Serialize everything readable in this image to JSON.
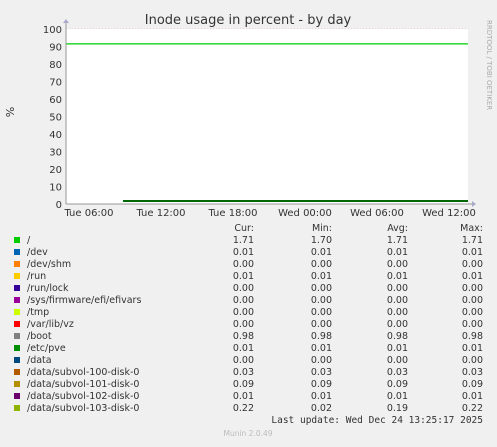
{
  "chart_data": {
    "type": "line",
    "title": "Inode usage in percent - by day",
    "ylabel": "%",
    "side_label": "RRDTOOL / TOBI OETIKER",
    "ylim": [
      0,
      100
    ],
    "y_ticks": [
      0,
      10,
      20,
      30,
      40,
      50,
      60,
      70,
      80,
      90,
      100
    ],
    "x_ticks": [
      "Tue 06:00",
      "Tue 12:00",
      "Tue 18:00",
      "Wed 00:00",
      "Wed 06:00",
      "Wed 12:00"
    ],
    "grid": true,
    "series": [
      {
        "name": "/",
        "color": "#00cc00",
        "values": [
          91.5
        ]
      },
      {
        "name": "/data/subvol-100-disk-0",
        "color": "#006600",
        "values": [
          1.71
        ]
      }
    ]
  },
  "legend": {
    "headers": [
      "Cur:",
      "Min:",
      "Avg:",
      "Max:"
    ],
    "rows": [
      {
        "name": "/",
        "color": "#00cc00",
        "cur": "1.71",
        "min": "1.70",
        "avg": "1.71",
        "max": "1.71"
      },
      {
        "name": "/dev",
        "color": "#0066b3",
        "cur": "0.01",
        "min": "0.01",
        "avg": "0.01",
        "max": "0.01"
      },
      {
        "name": "/dev/shm",
        "color": "#ff8000",
        "cur": "0.00",
        "min": "0.00",
        "avg": "0.00",
        "max": "0.00"
      },
      {
        "name": "/run",
        "color": "#ffcc00",
        "cur": "0.01",
        "min": "0.01",
        "avg": "0.01",
        "max": "0.01"
      },
      {
        "name": "/run/lock",
        "color": "#330099",
        "cur": "0.00",
        "min": "0.00",
        "avg": "0.00",
        "max": "0.00"
      },
      {
        "name": "/sys/firmware/efi/efivars",
        "color": "#990099",
        "cur": "0.00",
        "min": "0.00",
        "avg": "0.00",
        "max": "0.00"
      },
      {
        "name": "/tmp",
        "color": "#ccff00",
        "cur": "0.00",
        "min": "0.00",
        "avg": "0.00",
        "max": "0.00"
      },
      {
        "name": "/var/lib/vz",
        "color": "#ff0000",
        "cur": "0.00",
        "min": "0.00",
        "avg": "0.00",
        "max": "0.00"
      },
      {
        "name": "/boot",
        "color": "#808080",
        "cur": "0.98",
        "min": "0.98",
        "avg": "0.98",
        "max": "0.98"
      },
      {
        "name": "/etc/pve",
        "color": "#008f00",
        "cur": "0.01",
        "min": "0.01",
        "avg": "0.01",
        "max": "0.01"
      },
      {
        "name": "/data",
        "color": "#00487d",
        "cur": "0.00",
        "min": "0.00",
        "avg": "0.00",
        "max": "0.00"
      },
      {
        "name": "/data/subvol-100-disk-0",
        "color": "#b35a00",
        "cur": "0.03",
        "min": "0.03",
        "avg": "0.03",
        "max": "0.03"
      },
      {
        "name": "/data/subvol-101-disk-0",
        "color": "#b38f00",
        "cur": "0.09",
        "min": "0.09",
        "avg": "0.09",
        "max": "0.09"
      },
      {
        "name": "/data/subvol-102-disk-0",
        "color": "#6b006b",
        "cur": "0.01",
        "min": "0.01",
        "avg": "0.01",
        "max": "0.01"
      },
      {
        "name": "/data/subvol-103-disk-0",
        "color": "#8fb300",
        "cur": "0.22",
        "min": "0.02",
        "avg": "0.19",
        "max": "0.22"
      }
    ]
  },
  "last_update": "Last update: Wed Dec 24 13:25:17 2025",
  "footer": "Munin 2.0.49"
}
